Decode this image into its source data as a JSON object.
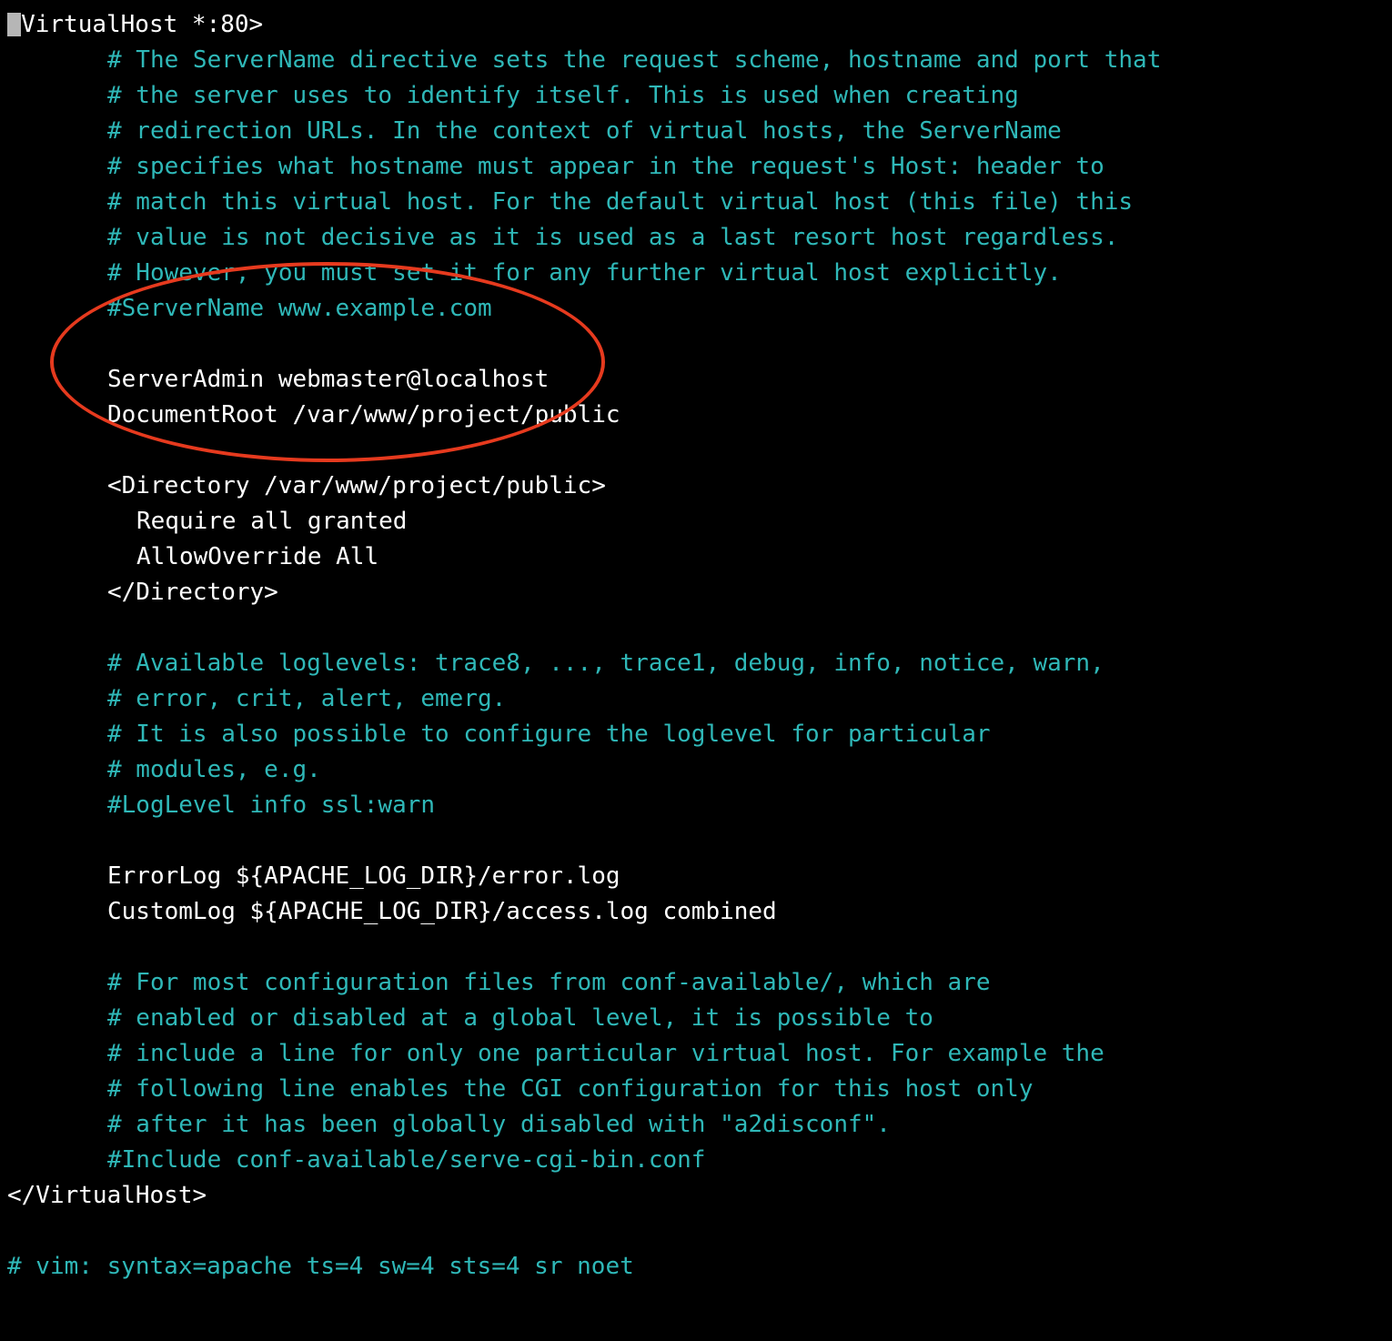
{
  "editor": {
    "lines": [
      {
        "cls": "white",
        "pad": 0,
        "cursor": true,
        "text": "<VirtualHost *:80>"
      },
      {
        "cls": "comment",
        "pad": 1,
        "text": "# The ServerName directive sets the request scheme, hostname and port that"
      },
      {
        "cls": "comment",
        "pad": 1,
        "text": "# the server uses to identify itself. This is used when creating"
      },
      {
        "cls": "comment",
        "pad": 1,
        "text": "# redirection URLs. In the context of virtual hosts, the ServerName"
      },
      {
        "cls": "comment",
        "pad": 1,
        "text": "# specifies what hostname must appear in the request's Host: header to"
      },
      {
        "cls": "comment",
        "pad": 1,
        "text": "# match this virtual host. For the default virtual host (this file) this"
      },
      {
        "cls": "comment",
        "pad": 1,
        "text": "# value is not decisive as it is used as a last resort host regardless."
      },
      {
        "cls": "comment",
        "pad": 1,
        "text": "# However, you must set it for any further virtual host explicitly."
      },
      {
        "cls": "comment",
        "pad": 1,
        "text": "#ServerName www.example.com"
      },
      {
        "cls": "white",
        "pad": 1,
        "text": ""
      },
      {
        "cls": "white",
        "pad": 1,
        "text": "ServerAdmin webmaster@localhost"
      },
      {
        "cls": "white",
        "pad": 1,
        "text": "DocumentRoot /var/www/project/public"
      },
      {
        "cls": "white",
        "pad": 1,
        "text": ""
      },
      {
        "cls": "white",
        "pad": 1,
        "text": "<Directory /var/www/project/public>"
      },
      {
        "cls": "white",
        "pad": 2,
        "text": "Require all granted"
      },
      {
        "cls": "white",
        "pad": 2,
        "text": "AllowOverride All"
      },
      {
        "cls": "white",
        "pad": 1,
        "text": "</Directory>"
      },
      {
        "cls": "white",
        "pad": 1,
        "text": ""
      },
      {
        "cls": "comment",
        "pad": 1,
        "text": "# Available loglevels: trace8, ..., trace1, debug, info, notice, warn,"
      },
      {
        "cls": "comment",
        "pad": 1,
        "text": "# error, crit, alert, emerg."
      },
      {
        "cls": "comment",
        "pad": 1,
        "text": "# It is also possible to configure the loglevel for particular"
      },
      {
        "cls": "comment",
        "pad": 1,
        "text": "# modules, e.g."
      },
      {
        "cls": "comment",
        "pad": 1,
        "text": "#LogLevel info ssl:warn"
      },
      {
        "cls": "white",
        "pad": 1,
        "text": ""
      },
      {
        "cls": "white",
        "pad": 1,
        "text": "ErrorLog ${APACHE_LOG_DIR}/error.log"
      },
      {
        "cls": "white",
        "pad": 1,
        "text": "CustomLog ${APACHE_LOG_DIR}/access.log combined"
      },
      {
        "cls": "white",
        "pad": 1,
        "text": ""
      },
      {
        "cls": "comment",
        "pad": 1,
        "text": "# For most configuration files from conf-available/, which are"
      },
      {
        "cls": "comment",
        "pad": 1,
        "text": "# enabled or disabled at a global level, it is possible to"
      },
      {
        "cls": "comment",
        "pad": 1,
        "text": "# include a line for only one particular virtual host. For example the"
      },
      {
        "cls": "comment",
        "pad": 1,
        "text": "# following line enables the CGI configuration for this host only"
      },
      {
        "cls": "comment",
        "pad": 1,
        "text": "# after it has been globally disabled with \"a2disconf\"."
      },
      {
        "cls": "comment",
        "pad": 1,
        "text": "#Include conf-available/serve-cgi-bin.conf"
      },
      {
        "cls": "white",
        "pad": 0,
        "text": "</VirtualHost>"
      },
      {
        "cls": "white",
        "pad": 0,
        "text": ""
      },
      {
        "cls": "comment",
        "pad": 0,
        "text": "# vim: syntax=apache ts=4 sw=4 sts=4 sr noet"
      }
    ]
  },
  "annotation": {
    "shape": "ellipse",
    "color": "#e63a1e",
    "description": "hand-drawn red circle highlighting ServerAdmin/DocumentRoot/Directory block"
  }
}
